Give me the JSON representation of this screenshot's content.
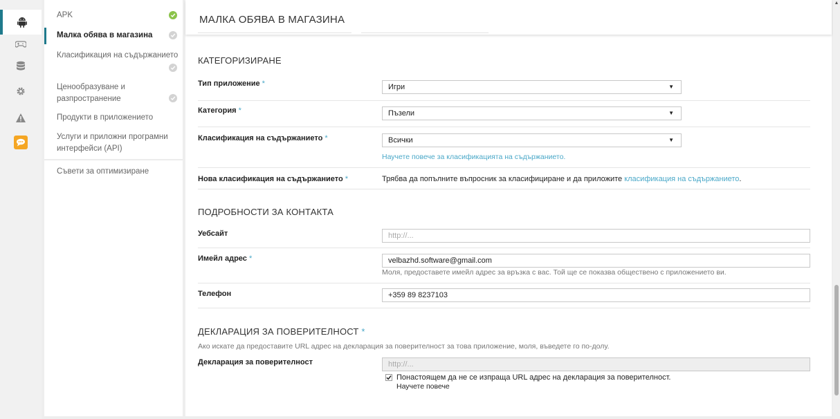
{
  "page": {
    "title": "МАЛКА ОБЯВА В МАГАЗИНА"
  },
  "rail": {
    "items": [
      {
        "icon": "android-icon",
        "active": true
      },
      {
        "icon": "gamepad-icon"
      },
      {
        "icon": "database-icon"
      },
      {
        "icon": "gear-icon"
      },
      {
        "icon": "warning-icon"
      },
      {
        "icon": "chat-badge-icon",
        "color": "#f5a623"
      }
    ]
  },
  "nav": {
    "apk": "APK",
    "store_listing": "Малка обява в магазина",
    "content_rating": "Класификация на съдържанието",
    "pricing": "Ценообразуване и разпространение",
    "in_app_products": "Продукти в приложението",
    "services_apis": "Услуги и приложни програмни интерфейси (API)",
    "optimization_tips": "Съвети за оптимизиране"
  },
  "categorization": {
    "title": "КАТЕГОРИЗИРАНЕ",
    "app_type_label": "Тип приложение",
    "app_type_value": "Игри",
    "category_label": "Категория",
    "category_value": "Пъзели",
    "content_rating_label": "Класификация на съдържанието",
    "content_rating_value": "Всички",
    "content_rating_link": "Научете повече за класификацията на съдържанието.",
    "new_rating_label": "Нова класификация на съдържанието",
    "new_rating_text": "Трябва да попълните въпросник за класифициране и да приложите ",
    "new_rating_link": "класификация на съдържанието",
    "new_rating_end": "."
  },
  "contact": {
    "title": "ПОДРОБНОСТИ ЗА КОНТАКТА",
    "website_label": "Уебсайт",
    "website_placeholder": "http://...",
    "email_label": "Имейл адрес",
    "email_value": "velbazhd.software@gmail.com",
    "email_help": "Моля, предоставете имейл адрес за връзка с вас. Той ще се показва обществено с приложението ви.",
    "phone_label": "Телефон",
    "phone_value": "+359 89 8237103"
  },
  "privacy": {
    "title": "ДЕКЛАРАЦИЯ ЗА ПОВЕРИТЕЛНОСТ",
    "asterisk": "*",
    "description": "Ако искате да предоставите URL адрес на декларация за поверителност за това приложение, моля, въведете го по-долу.",
    "field_label": "Декларация за поверителност",
    "field_placeholder": "http://...",
    "checkbox_label": "Понастоящем да не се изпраща URL адрес на декларация за поверителност.",
    "checkbox_checked": true,
    "learn_more": "Научете повече"
  },
  "colors": {
    "accent": "#4aa8c8",
    "check_green": "#8bc34a",
    "rail_active": "#1f7a8c"
  }
}
